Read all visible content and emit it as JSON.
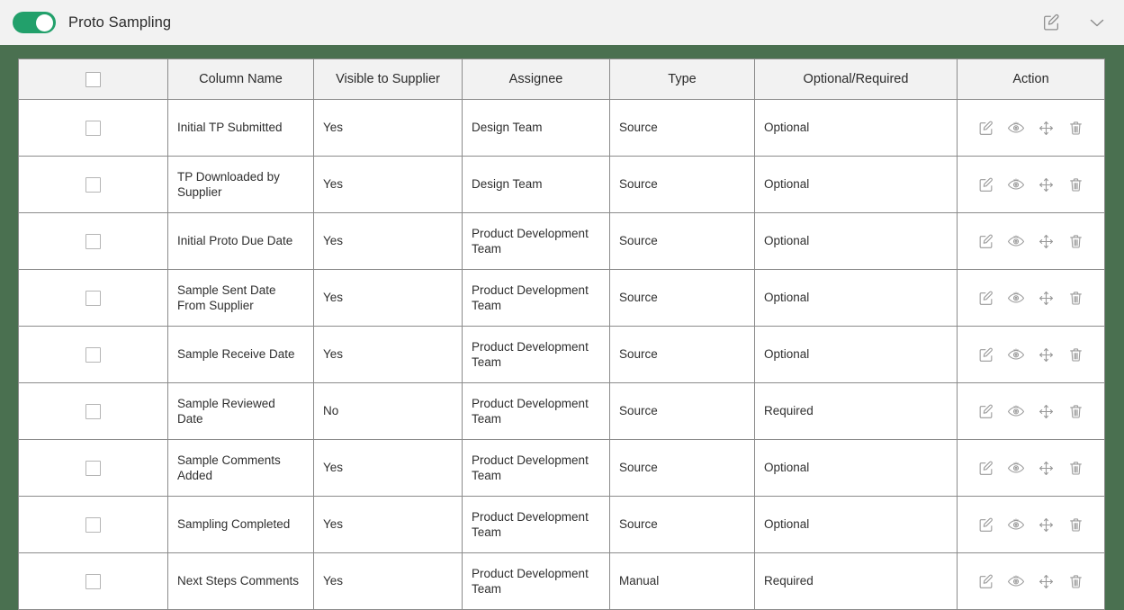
{
  "topbar": {
    "toggle_state": "on",
    "toggle_name": "proto-sampling-toggle",
    "title": "Proto Sampling",
    "edit_icon": "edit-square-icon",
    "chevron_icon": "chevron-down-icon"
  },
  "theme": {
    "accent_green": "#4a7050",
    "toggle_green": "#22a06b",
    "header_bg": "#f2f2f2",
    "grid_line": "#8b8b8b",
    "icon_gray": "#9a9a9a"
  },
  "table": {
    "select_all_checkbox": "",
    "headers": [
      "",
      "Column Name",
      "Visible to Supplier",
      "Assignee",
      "Type",
      "Optional/Required",
      "Action"
    ],
    "row_actions": [
      {
        "name": "edit-icon",
        "label": "Edit"
      },
      {
        "name": "eye-icon",
        "label": "View"
      },
      {
        "name": "move-icon",
        "label": "Move"
      },
      {
        "name": "trash-icon",
        "label": "Delete"
      }
    ],
    "rows": [
      {
        "column_name": "Initial TP Submitted",
        "visible_to_supplier": "Yes",
        "assignee": "Design Team",
        "type": "Source",
        "optional_required": "Optional"
      },
      {
        "column_name": "TP Downloaded by Supplier",
        "visible_to_supplier": "Yes",
        "assignee": "Design Team",
        "type": "Source",
        "optional_required": "Optional"
      },
      {
        "column_name": "Initial Proto Due Date",
        "visible_to_supplier": "Yes",
        "assignee": "Product Development Team",
        "type": "Source",
        "optional_required": "Optional"
      },
      {
        "column_name": "Sample Sent Date From Supplier",
        "visible_to_supplier": "Yes",
        "assignee": "Product Development Team",
        "type": "Source",
        "optional_required": "Optional"
      },
      {
        "column_name": "Sample Receive Date",
        "visible_to_supplier": "Yes",
        "assignee": "Product Development Team",
        "type": "Source",
        "optional_required": "Optional"
      },
      {
        "column_name": "Sample Reviewed Date",
        "visible_to_supplier": "No",
        "assignee": "Product Development Team",
        "type": "Source",
        "optional_required": "Required"
      },
      {
        "column_name": "Sample Comments Added",
        "visible_to_supplier": "Yes",
        "assignee": "Product Development Team",
        "type": "Source",
        "optional_required": "Optional"
      },
      {
        "column_name": "Sampling Completed",
        "visible_to_supplier": "Yes",
        "assignee": "Product Development Team",
        "type": "Source",
        "optional_required": "Optional"
      },
      {
        "column_name": "Next Steps Comments",
        "visible_to_supplier": "Yes",
        "assignee": "Product Development Team",
        "type": "Manual",
        "optional_required": "Required"
      }
    ]
  }
}
